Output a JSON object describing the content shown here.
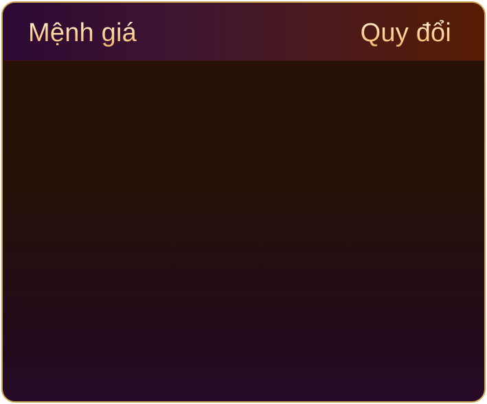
{
  "table": {
    "header": {
      "denomination_label": "Mệnh giá",
      "conversion_label": "Quy đổi"
    },
    "rows": []
  }
}
